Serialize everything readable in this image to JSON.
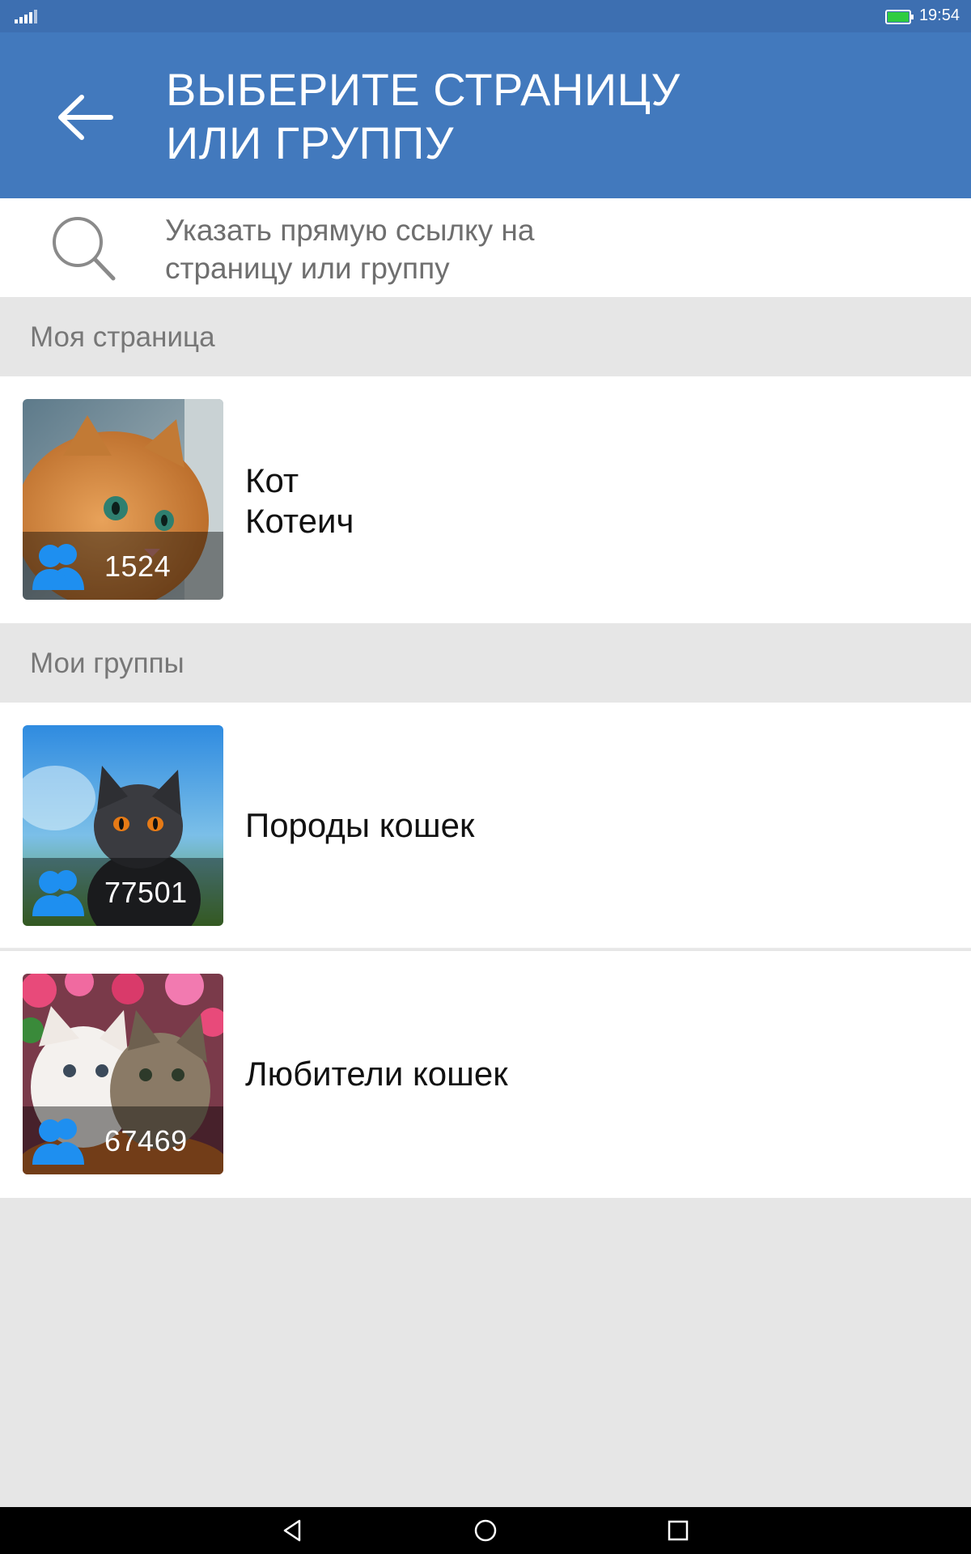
{
  "status_bar": {
    "time": "19:54",
    "battery_color": "#2ecc40"
  },
  "app_bar": {
    "title_line1": "ВЫБЕРИТЕ СТРАНИЦУ",
    "title_line2": "ИЛИ ГРУППУ",
    "back_icon": "arrow-left-icon",
    "color": "#4279bd"
  },
  "search": {
    "line1": "Указать прямую ссылку на",
    "line2": "страницу или группу",
    "icon": "search-icon"
  },
  "my_page": {
    "header": "Моя страница",
    "items": [
      {
        "name_line1": "Кот",
        "name_line2": "Котеич",
        "count": "1524"
      }
    ]
  },
  "my_groups": {
    "header": "Мои группы",
    "items": [
      {
        "name": "Породы кошек",
        "count": "77501"
      },
      {
        "name": "Любители кошек",
        "count": "67469"
      }
    ]
  },
  "accent_color": "#1e8ff0"
}
